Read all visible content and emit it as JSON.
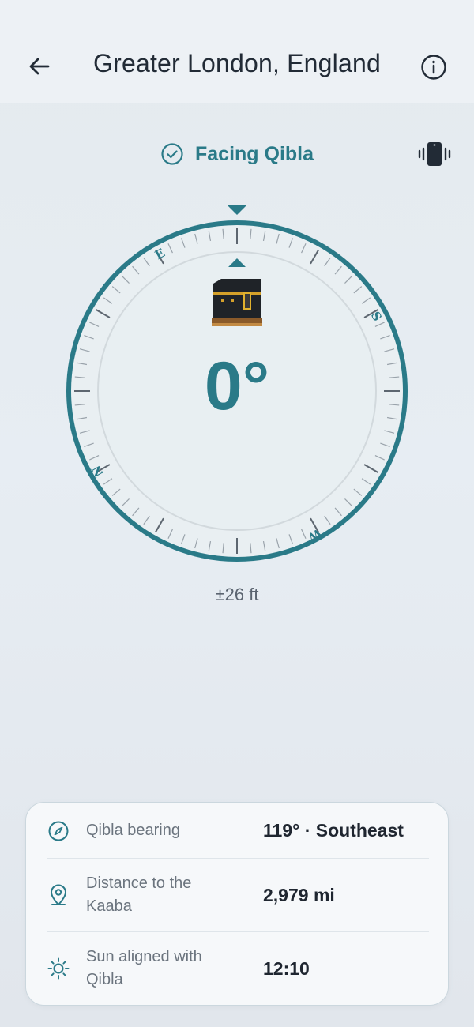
{
  "header": {
    "title": "Greater London, England",
    "back_icon": "arrow-left-icon",
    "info_icon": "info-icon"
  },
  "status": {
    "text": "Facing Qibla",
    "icon": "check-circle-icon",
    "vibrate_icon": "vibrate-icon"
  },
  "compass": {
    "degree": "0°",
    "letters": [
      "E",
      "S",
      "W",
      "N"
    ],
    "kaaba_icon": "kaaba-icon"
  },
  "accuracy": "±26 ft",
  "info_card": {
    "rows": [
      {
        "icon": "compass-icon",
        "label": "Qibla bearing",
        "value": "119° · Southeast"
      },
      {
        "icon": "location-pin-icon",
        "label": "Distance to the Kaaba",
        "value": "2,979 mi"
      },
      {
        "icon": "sun-icon",
        "label": "Sun aligned with Qibla",
        "value": "12:10"
      }
    ]
  },
  "colors": {
    "accent": "#2a7a88",
    "ring": "#2a7a88",
    "text_dark": "#222b36"
  }
}
